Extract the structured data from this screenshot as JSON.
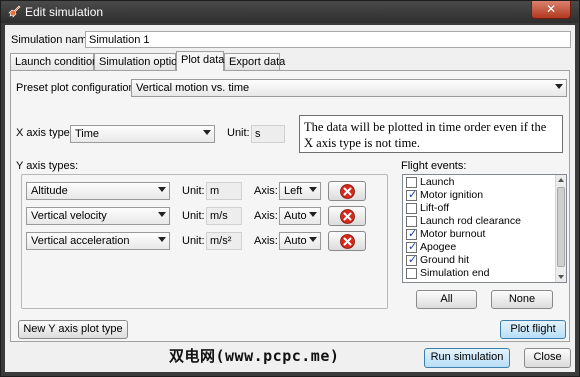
{
  "window": {
    "title": "Edit simulation",
    "close_label": "✕"
  },
  "simulation": {
    "name_label": "Simulation name:",
    "name_value": "Simulation 1"
  },
  "tabs": [
    {
      "label": "Launch conditions"
    },
    {
      "label": "Simulation options"
    },
    {
      "label": "Plot data"
    },
    {
      "label": "Export data"
    }
  ],
  "plot": {
    "preset_label": "Preset plot configurations:",
    "preset_value": "Vertical motion vs. time",
    "xaxis_label": "X axis type:",
    "xaxis_value": "Time",
    "unit_label": "Unit:",
    "xaxis_unit": "s",
    "note": "The data will be plotted in time order even if the X axis type is not time.",
    "yaxis_types_label": "Y axis types:",
    "axis_label": "Axis:",
    "yaxes": [
      {
        "type": "Altitude",
        "unit": "m",
        "axis": "Left"
      },
      {
        "type": "Vertical velocity",
        "unit": "m/s",
        "axis": "Auto"
      },
      {
        "type": "Vertical acceleration",
        "unit": "m/s²",
        "axis": "Auto"
      }
    ],
    "new_yaxis_button": "New Y axis plot type",
    "flight_events_label": "Flight events:",
    "events": [
      {
        "label": "Launch",
        "checked": false
      },
      {
        "label": "Motor ignition",
        "checked": true
      },
      {
        "label": "Lift-off",
        "checked": false
      },
      {
        "label": "Launch rod clearance",
        "checked": false
      },
      {
        "label": "Motor burnout",
        "checked": true
      },
      {
        "label": "Apogee",
        "checked": true
      },
      {
        "label": "Ground hit",
        "checked": true
      },
      {
        "label": "Simulation end",
        "checked": false
      }
    ],
    "all_button": "All",
    "none_button": "None",
    "plot_flight_button": "Plot flight"
  },
  "footer": {
    "run_button": "Run simulation",
    "close_button": "Close"
  },
  "watermark": "双电网(www.pcpc.me)",
  "colors": {
    "delete_red": "#d42a1c",
    "accent_blue": "#b8def7",
    "title_bar": "#2e2e2e"
  }
}
